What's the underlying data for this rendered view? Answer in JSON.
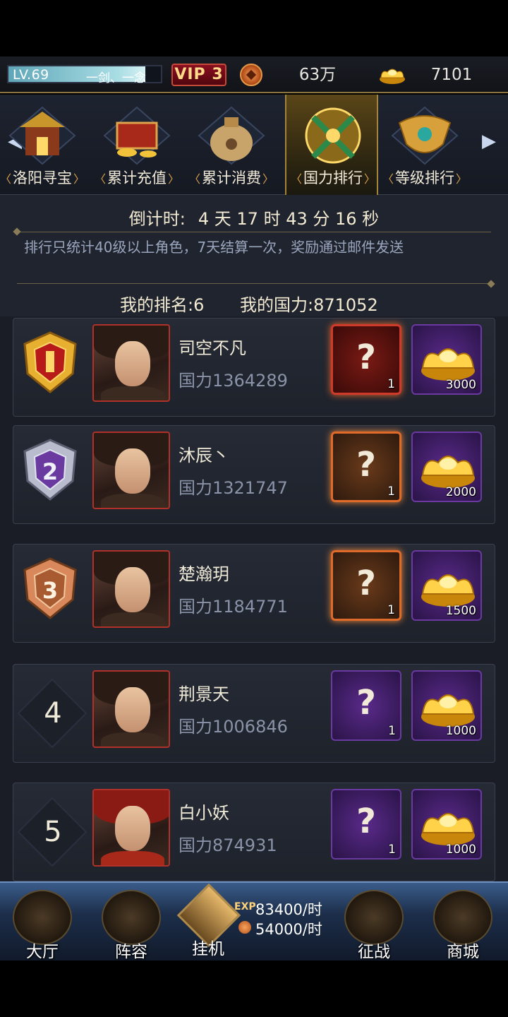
{
  "status": {
    "level": "LV.69",
    "player_name": "一剑、一念",
    "level_progress": 0.9,
    "vip": "VIP 3",
    "copper_coins": "63万",
    "gold_ingots": "7101"
  },
  "tabs": [
    {
      "label": "洛阳寻宝",
      "icon": "treasure-pavilion-icon"
    },
    {
      "label": "累计充值",
      "icon": "treasure-chest-icon"
    },
    {
      "label": "累计消费",
      "icon": "money-bag-icon"
    },
    {
      "label": "国力排行",
      "icon": "crossed-swords-emblem-icon",
      "active": true
    },
    {
      "label": "等级排行",
      "icon": "golden-crest-icon"
    }
  ],
  "info": {
    "countdown_label": "倒计时:",
    "countdown_value": "4 天 17 时 43 分 16 秒",
    "note": "排行只统计40级以上角色，7天结算一次，奖励通过邮件发送",
    "my_rank_label": "我的排名:",
    "my_rank": "6",
    "my_power_label": "我的国力:",
    "my_power": "871052"
  },
  "ranking": [
    {
      "rank": "1",
      "name": "司空不凡",
      "power": "国力1364289",
      "box_count": "1",
      "gold_count": "3000"
    },
    {
      "rank": "2",
      "name": "沐辰丶",
      "power": "国力1321747",
      "box_count": "1",
      "gold_count": "2000"
    },
    {
      "rank": "3",
      "name": "楚瀚玥",
      "power": "国力1184771",
      "box_count": "1",
      "gold_count": "1500"
    },
    {
      "rank": "4",
      "name": "荆景天",
      "power": "国力1006846",
      "box_count": "1",
      "gold_count": "1000"
    },
    {
      "rank": "5",
      "name": "白小妖",
      "power": "国力874931",
      "box_count": "1",
      "gold_count": "1000"
    }
  ],
  "nav": {
    "hall": "大厅",
    "lineup": "阵容",
    "idle": "挂机",
    "exp_tag": "EXP",
    "exp_rate": "83400/时",
    "coin_rate": "54000/时",
    "battle": "征战",
    "shop": "商城"
  },
  "colors": {
    "accent_gold": "#e0a44a",
    "vip_red": "#8b0f1f",
    "nav_blue": "#3a5c8a"
  }
}
